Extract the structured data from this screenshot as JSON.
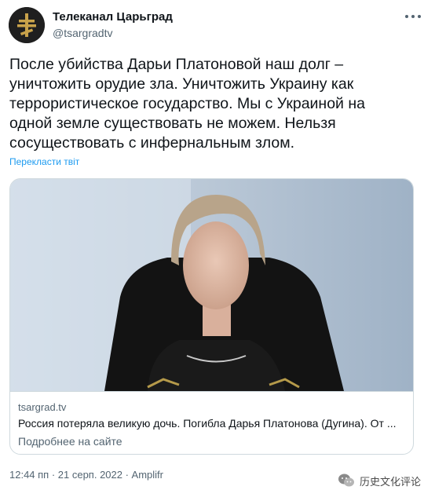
{
  "account": {
    "name": "Телеканал Царьград",
    "handle": "@tsargradtv"
  },
  "tweet": {
    "text": "После убийства Дарьи Платоновой наш долг –\nуничтожить орудие зла. Уничтожить Украину как\nтеррористическое государство. Мы с Украиной на\nодной земле существовать не можем. Нельзя\nсосуществовать с инфернальным злом.",
    "translate_label": "Перекласти твіт"
  },
  "card": {
    "domain": "tsargrad.tv",
    "title": "Россия потеряла великую дочь. Погибла Дарья Платонова (Дугина). От ...",
    "description": "Подробнее на сайте"
  },
  "meta": {
    "timestamp": "12:44 пп · 21 серп. 2022 · Amplifr"
  },
  "watermark": {
    "text": "历史文化评论"
  },
  "icons": {
    "more": "more-options-icon",
    "avatar_logo": "orthodox-cross-logo",
    "watermark": "wechat-icon"
  },
  "colors": {
    "link": "#1d9bf0",
    "secondary_text": "#536471",
    "primary_text": "#0f1419",
    "avatar_gold": "#c8a24a",
    "card_border": "#cfd9de"
  }
}
